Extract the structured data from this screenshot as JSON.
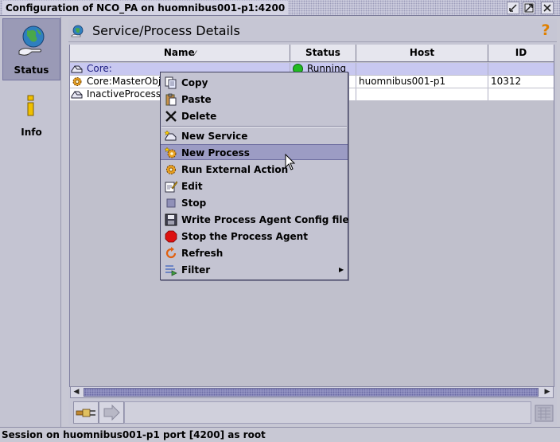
{
  "window": {
    "title": "Configuration of NCO_PA on huomnibus001-p1:4200",
    "buttons": [
      "minimize",
      "maximize",
      "close"
    ]
  },
  "nav": {
    "items": [
      {
        "label": "Status",
        "icon": "globe-hand-icon",
        "selected": true
      },
      {
        "label": "Info",
        "icon": "info-icon",
        "selected": false
      }
    ]
  },
  "panel": {
    "title": "Service/Process Details",
    "help_glyph": "?"
  },
  "table": {
    "columns": [
      "Name",
      "Status",
      "Host",
      "ID"
    ],
    "sort_indicator": "⁄",
    "rows": [
      {
        "name": "Core:",
        "status": "Running",
        "host": "",
        "id": "",
        "icon": "service-icon",
        "status_color": "#22bb22",
        "selected": true
      },
      {
        "name": "Core:MasterObjServ",
        "status": "",
        "host": "huomnibus001-p1",
        "id": "10312",
        "icon": "gear-icon",
        "selected": false
      },
      {
        "name": "InactiveProcesses",
        "status": "",
        "host": "",
        "id": "",
        "icon": "service-icon",
        "selected": false
      }
    ]
  },
  "context_menu": {
    "items": [
      {
        "label": "Copy",
        "icon": "copy-icon"
      },
      {
        "label": "Paste",
        "icon": "paste-icon"
      },
      {
        "label": "Delete",
        "icon": "delete-icon"
      },
      {
        "label": "New Service",
        "icon": "new-service-icon"
      },
      {
        "label": "New Process",
        "icon": "new-process-icon",
        "highlighted": true
      },
      {
        "label": "Run External Action",
        "icon": "gear-icon"
      },
      {
        "label": "Edit",
        "icon": "edit-icon"
      },
      {
        "label": "Stop",
        "icon": "stop-icon"
      },
      {
        "label": "Write Process Agent Config file",
        "icon": "save-icon"
      },
      {
        "label": "Stop the Process Agent",
        "icon": "stop-sign-icon"
      },
      {
        "label": "Refresh",
        "icon": "refresh-icon"
      },
      {
        "label": "Filter",
        "icon": "filter-icon",
        "submenu": true
      }
    ]
  },
  "toolbar": {
    "buttons": [
      {
        "name": "connect",
        "icon": "plug-icon",
        "enabled": true
      },
      {
        "name": "execute",
        "icon": "arrow-icon",
        "enabled": false
      }
    ]
  },
  "statusbar": {
    "text": "Session on huomnibus001-p1 port [4200] as root"
  },
  "colors": {
    "background": "#c8c8d4",
    "selection": "#9c9cc4",
    "running": "#22bb22",
    "stop_red": "#dd1111"
  }
}
